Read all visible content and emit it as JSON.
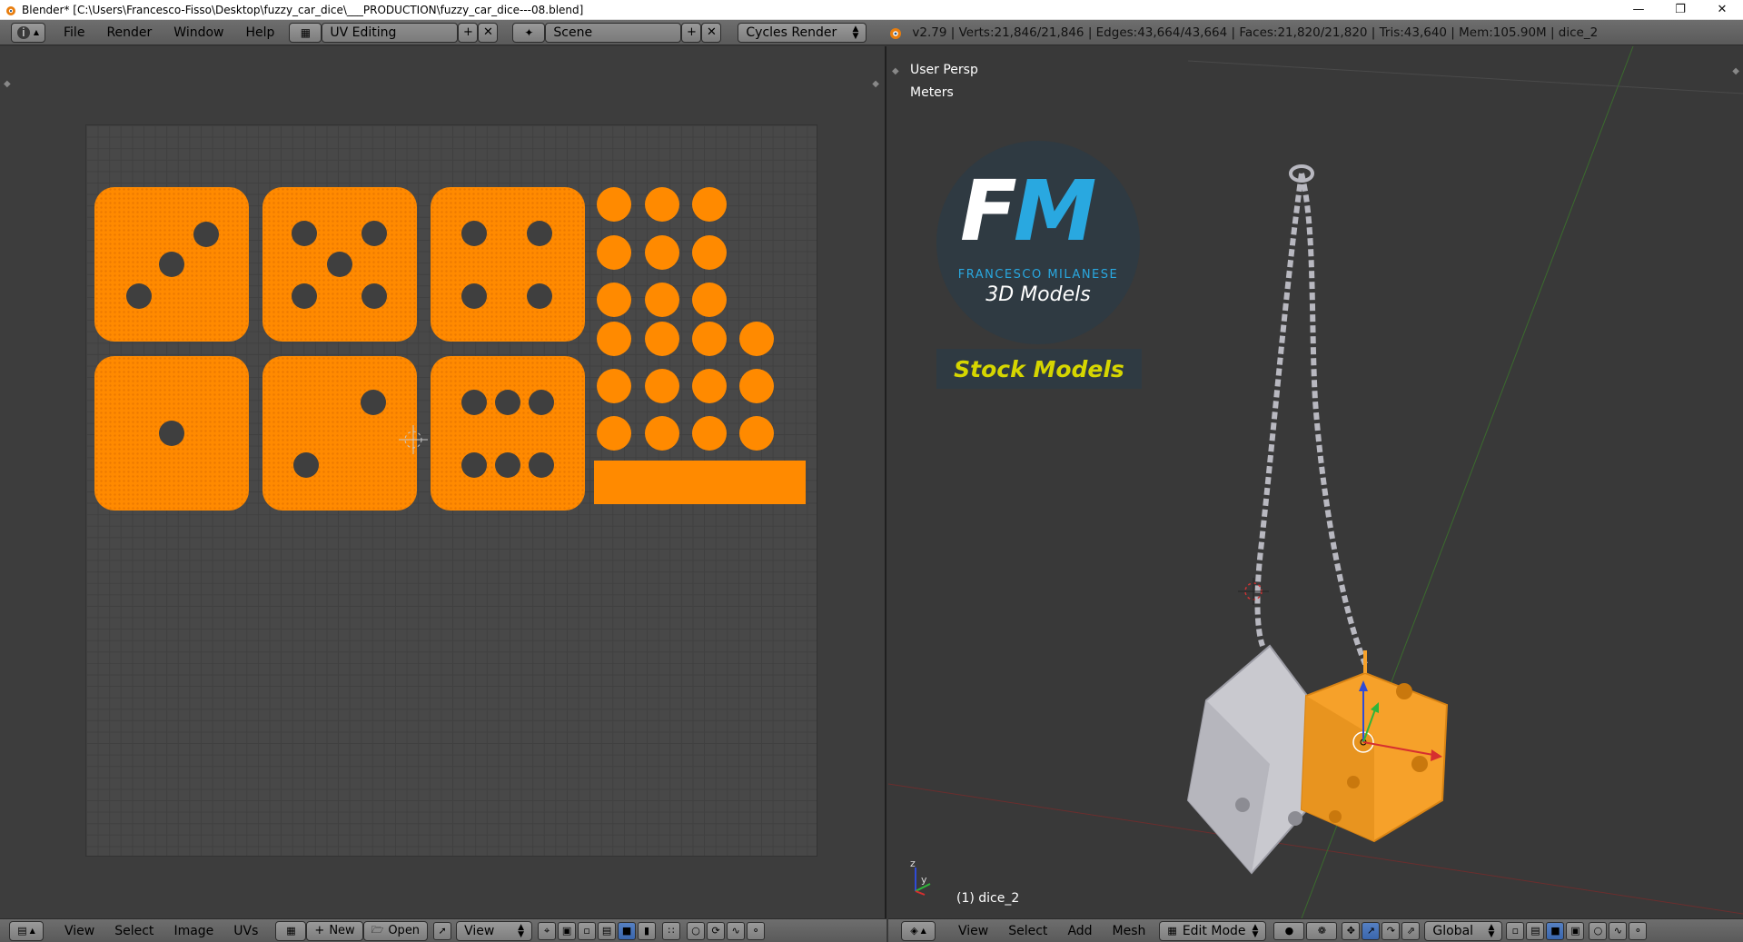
{
  "window": {
    "title": "Blender* [C:\\Users\\Francesco-Fisso\\Desktop\\fuzzy_car_dice\\___PRODUCTION\\fuzzy_car_dice---08.blend]",
    "controls": [
      "minimize",
      "restore",
      "close"
    ]
  },
  "topbar": {
    "menus": [
      "File",
      "Render",
      "Window",
      "Help"
    ],
    "screen_layout": "UV Editing",
    "scene": "Scene",
    "render_engine": "Cycles Render",
    "stats": "v2.79 | Verts:21,846/21,846 | Edges:43,664/43,664 | Faces:21,820/21,820 | Tris:43,640 | Mem:105.90M | dice_2"
  },
  "uv_editor": {
    "menus": [
      "View",
      "Select",
      "Image",
      "UVs"
    ],
    "buttons": {
      "new": "New",
      "open": "Open",
      "view": "View"
    }
  },
  "viewport": {
    "view_label": "User Persp",
    "units_label": "Meters",
    "object_label": "(1) dice_2",
    "menus": [
      "View",
      "Select",
      "Add",
      "Mesh"
    ],
    "mode": "Edit Mode",
    "orientation": "Global",
    "logo": {
      "monogram_f": "F",
      "monogram_m": "M",
      "name": "FRANCESCO MILANESE",
      "tagline": "3D Models",
      "badge": "Stock Models"
    }
  },
  "colors": {
    "uv_orange": "#ff8a00",
    "mesh_orange": "#f6a12a",
    "logo_bg": "#2f3a42",
    "logo_blue": "#29a8e0",
    "badge_yellow": "#d6d600"
  }
}
